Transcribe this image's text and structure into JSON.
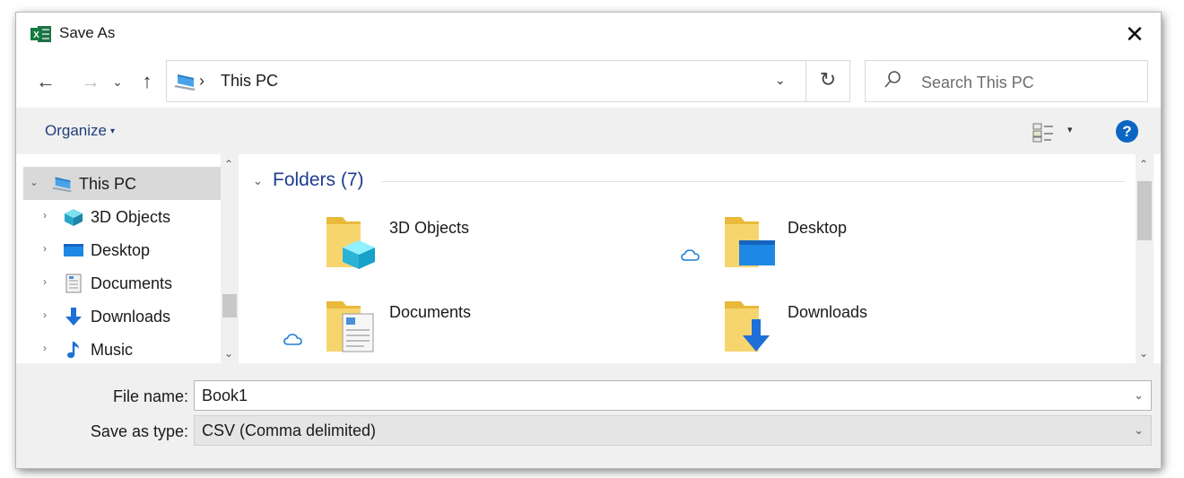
{
  "window": {
    "title": "Save As",
    "app_icon": "excel-icon",
    "close_glyph": "✕"
  },
  "nav": {
    "back_glyph": "←",
    "forward_glyph": "→",
    "recent_glyph": "⌄",
    "up_glyph": "↑",
    "address_sep": "›",
    "address_path": "This PC",
    "refresh_glyph": "↻",
    "dropdown_glyph": "⌄"
  },
  "search": {
    "placeholder": "Search This PC",
    "icon_glyph": "⚲"
  },
  "toolbar": {
    "organize_label": "Organize",
    "organize_caret": "▾",
    "view_caret": "▾",
    "help_glyph": "?"
  },
  "tree": {
    "items": [
      {
        "label": "This PC",
        "icon": "this-pc-icon",
        "expander": "⌄",
        "selected": true
      },
      {
        "label": "3D Objects",
        "icon": "3d-objects-icon",
        "expander": "›"
      },
      {
        "label": "Desktop",
        "icon": "desktop-icon",
        "expander": "›"
      },
      {
        "label": "Documents",
        "icon": "documents-icon",
        "expander": "›"
      },
      {
        "label": "Downloads",
        "icon": "downloads-icon",
        "expander": "›"
      },
      {
        "label": "Music",
        "icon": "music-icon",
        "expander": "›"
      }
    ],
    "scroll_up": "⌃",
    "scroll_down": "⌄"
  },
  "content": {
    "group_chevron": "⌄",
    "group_title": "Folders (7)",
    "folders": [
      {
        "label": "3D Objects",
        "icon": "3d-objects-folder-icon",
        "cloud": false
      },
      {
        "label": "Desktop",
        "icon": "desktop-folder-icon",
        "cloud": true
      },
      {
        "label": "Documents",
        "icon": "documents-folder-icon",
        "cloud": true
      },
      {
        "label": "Downloads",
        "icon": "downloads-folder-icon",
        "cloud": false
      }
    ]
  },
  "form": {
    "filename_label": "File name:",
    "filename_value": "Book1",
    "savetype_label": "Save as type:",
    "savetype_value": "CSV (Comma delimited)",
    "dropdown_glyph": "⌄"
  },
  "colors": {
    "accent_blue": "#0b66c2",
    "link_blue": "#1e3d8f",
    "selected_bg": "#d9d9d9",
    "pane_bg": "#f0f0f0",
    "folder_yellow": "#f3c84b"
  }
}
